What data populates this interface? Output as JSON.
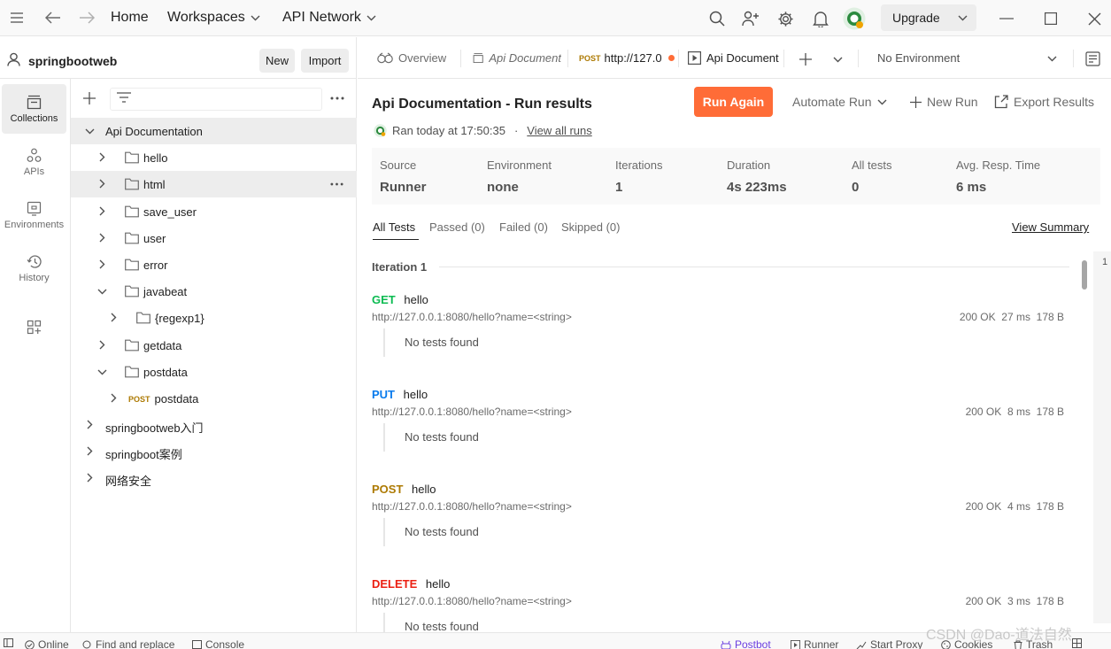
{
  "topbar": {
    "home": "Home",
    "workspaces": "Workspaces",
    "api_network": "API Network",
    "upgrade": "Upgrade"
  },
  "sidebar": {
    "workspace_name": "springbootweb",
    "new_label": "New",
    "import_label": "Import",
    "rail": [
      {
        "label": "Collections"
      },
      {
        "label": "APIs"
      },
      {
        "label": "Environments"
      },
      {
        "label": "History"
      }
    ],
    "tree": [
      {
        "label": "Api Documentation"
      },
      {
        "label": "hello"
      },
      {
        "label": "html"
      },
      {
        "label": "save_user"
      },
      {
        "label": "user"
      },
      {
        "label": "error"
      },
      {
        "label": "javabeat"
      },
      {
        "label": "{regexp1}"
      },
      {
        "label": "getdata"
      },
      {
        "label": "postdata"
      },
      {
        "method": "POST",
        "label": "postdata"
      },
      {
        "label": "springbootweb入门"
      },
      {
        "label": "springboot案例"
      },
      {
        "label": "网络安全"
      }
    ]
  },
  "tabs": {
    "overview": "Overview",
    "api_doc_1": "Api Document",
    "post_method": "POST",
    "post_url": "http://127.0",
    "api_doc_2": "Api Document",
    "environment": "No Environment"
  },
  "run": {
    "title": "Api Documentation - Run results",
    "ran_at": "Ran today at 17:50:35",
    "dot": "·",
    "view_all_runs": "View all runs",
    "run_again": "Run Again",
    "automate_run": "Automate Run",
    "new_run": "New Run",
    "export_results": "Export Results",
    "stats": [
      {
        "label": "Source",
        "value": "Runner"
      },
      {
        "label": "Environment",
        "value": "none"
      },
      {
        "label": "Iterations",
        "value": "1"
      },
      {
        "label": "Duration",
        "value": "4s 223ms"
      },
      {
        "label": "All tests",
        "value": "0"
      },
      {
        "label": "Avg. Resp. Time",
        "value": "6 ms"
      }
    ],
    "filter_tabs": {
      "all": "All Tests",
      "passed": "Passed (0)",
      "failed": "Failed (0)",
      "skipped": "Skipped (0)"
    },
    "view_summary": "View Summary",
    "iteration": "Iteration 1",
    "scroll_index": "1",
    "requests": [
      {
        "method": "GET",
        "color": "#0cbb52",
        "name": "hello",
        "url": "http://127.0.0.1:8080/hello?name=<string>",
        "status": "200 OK",
        "time": "27 ms",
        "size": "178 B",
        "note": "No tests found"
      },
      {
        "method": "PUT",
        "color": "#097bed",
        "name": "hello",
        "url": "http://127.0.0.1:8080/hello?name=<string>",
        "status": "200 OK",
        "time": "8 ms",
        "size": "178 B",
        "note": "No tests found"
      },
      {
        "method": "POST",
        "color": "#ad7a03",
        "name": "hello",
        "url": "http://127.0.0.1:8080/hello?name=<string>",
        "status": "200 OK",
        "time": "4 ms",
        "size": "178 B",
        "note": "No tests found"
      },
      {
        "method": "DELETE",
        "color": "#eb2013",
        "name": "hello",
        "url": "http://127.0.0.1:8080/hello?name=<string>",
        "status": "200 OK",
        "time": "3 ms",
        "size": "178 B",
        "note": "No tests found"
      }
    ]
  },
  "statusbar": {
    "online": "Online",
    "find_replace": "Find and replace",
    "console": "Console",
    "postbot": "Postbot",
    "runner": "Runner",
    "start_proxy": "Start Proxy",
    "cookies": "Cookies",
    "trash": "Trash"
  },
  "watermark": "CSDN @Dao-道法自然",
  "colors": {
    "accent": "#ff6c37",
    "get": "#0cbb52",
    "put": "#097bed",
    "post": "#ad7a03",
    "delete": "#eb2013"
  }
}
